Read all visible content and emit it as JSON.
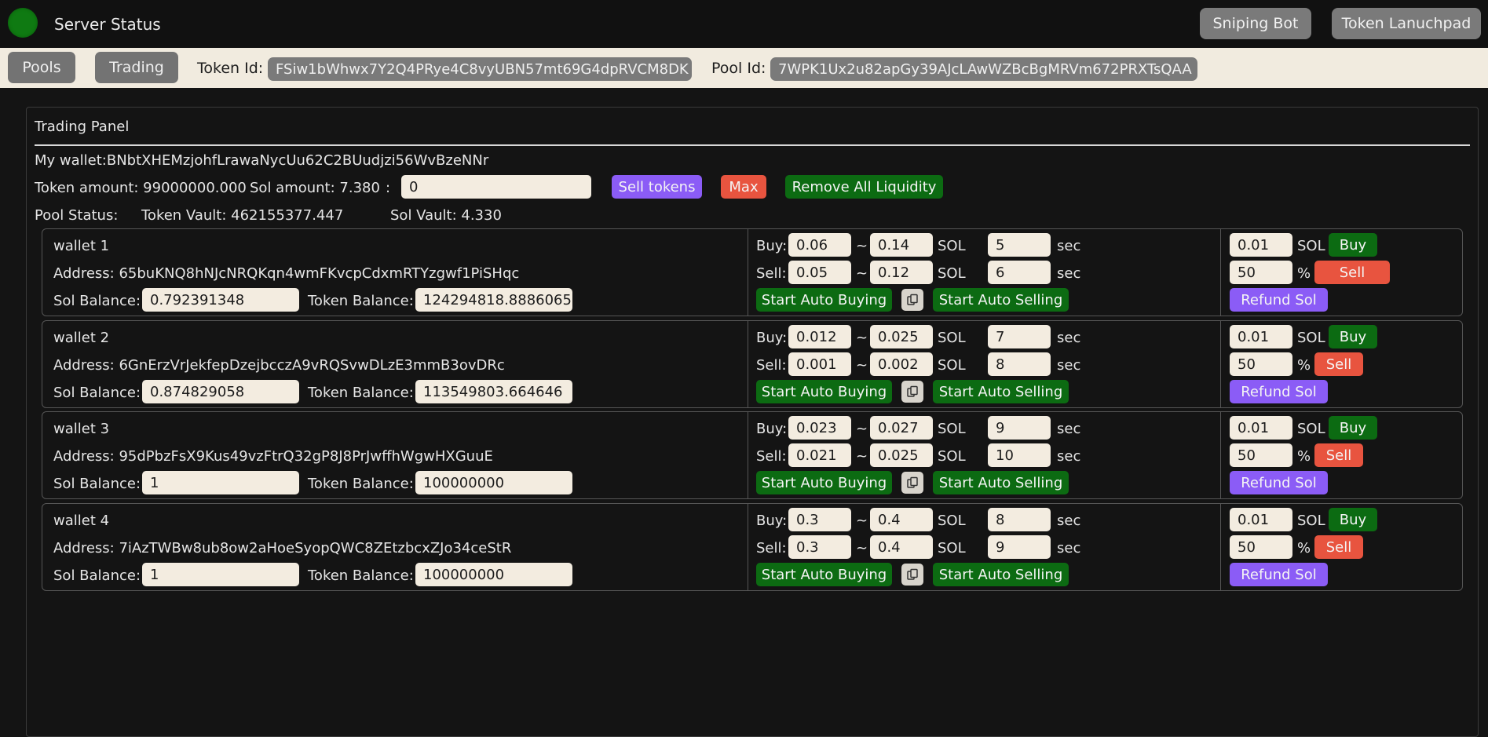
{
  "topbar": {
    "title": "Server Status",
    "buttons": [
      "Sniping Bot",
      "Token Lanuchpad"
    ]
  },
  "subbar": {
    "tabs": [
      "Pools",
      "Trading"
    ],
    "token_id_label": "Token Id:",
    "token_id": "FSiw1bWhwx7Y2Q4PRye4C8vyUBN57mt69G4dpRVCM8DK",
    "pool_id_label": "Pool Id:",
    "pool_id": "7WPK1Ux2u82apGy39AJcLAwWZBcBgMRVm672PRXTsQAA"
  },
  "panel": {
    "title": "Trading Panel",
    "my_wallet": "My wallet:BNbtXHEMzjohfLrawaNycUu62C2BUudjzi56WvBzeNNr",
    "token_amount": "Token amount: 99000000.000",
    "sol_amount": "Sol amount: 7.380",
    "colon": ":",
    "sell_input": "0",
    "sell_tokens": "Sell tokens",
    "max": "Max",
    "remove_liquidity": "Remove All Liquidity",
    "pool_status": "Pool Status:",
    "token_vault": "Token Vault: 462155377.447",
    "sol_vault": "Sol Vault: 4.330"
  },
  "labels": {
    "buy": "Buy:",
    "sell": "Sell:",
    "tilde": "~",
    "sol": "SOL",
    "sec": "sec",
    "percent": "%",
    "sol_balance": "Sol Balance:",
    "token_balance": "Token Balance:",
    "start_auto_buying": "Start Auto Buying",
    "start_auto_selling": "Start Auto Selling",
    "buy_btn": "Buy",
    "sell_btn": "Sell",
    "refund_sol": "Refund Sol"
  },
  "wallets": [
    {
      "name": "wallet 1",
      "address": "Address: 65buKNQ8hNJcNRQKqn4wmFKvcpCdxmRTYzgwf1PiSHqc",
      "sol_balance": "0.792391348",
      "token_balance": "124294818.8886065",
      "buy_min": "0.06",
      "buy_max": "0.14",
      "buy_sec": "5",
      "sell_min": "0.05",
      "sell_max": "0.12",
      "sell_sec": "6",
      "buy_amount": "0.01",
      "sell_percent": "50"
    },
    {
      "name": "wallet 2",
      "address": "Address: 6GnErzVrJekfepDzejbcczA9vRQSvwDLzE3mmB3ovDRc",
      "sol_balance": "0.874829058",
      "token_balance": "113549803.664646",
      "buy_min": "0.012",
      "buy_max": "0.025",
      "buy_sec": "7",
      "sell_min": "0.001",
      "sell_max": "0.002",
      "sell_sec": "8",
      "buy_amount": "0.01",
      "sell_percent": "50"
    },
    {
      "name": "wallet 3",
      "address": "Address: 95dPbzFsX9Kus49vzFtrQ32gP8J8PrJwffhWgwHXGuuE",
      "sol_balance": "1",
      "token_balance": "100000000",
      "buy_min": "0.023",
      "buy_max": "0.027",
      "buy_sec": "9",
      "sell_min": "0.021",
      "sell_max": "0.025",
      "sell_sec": "10",
      "buy_amount": "0.01",
      "sell_percent": "50"
    },
    {
      "name": "wallet 4",
      "address": "Address: 7iAzTWBw8ub8ow2aHoeSyopQWC8ZEtzbcxZJo34ceStR",
      "sol_balance": "1",
      "token_balance": "100000000",
      "buy_min": "0.3",
      "buy_max": "0.4",
      "buy_sec": "8",
      "sell_min": "0.3",
      "sell_max": "0.4",
      "sell_sec": "9",
      "buy_amount": "0.01",
      "sell_percent": "50"
    }
  ]
}
